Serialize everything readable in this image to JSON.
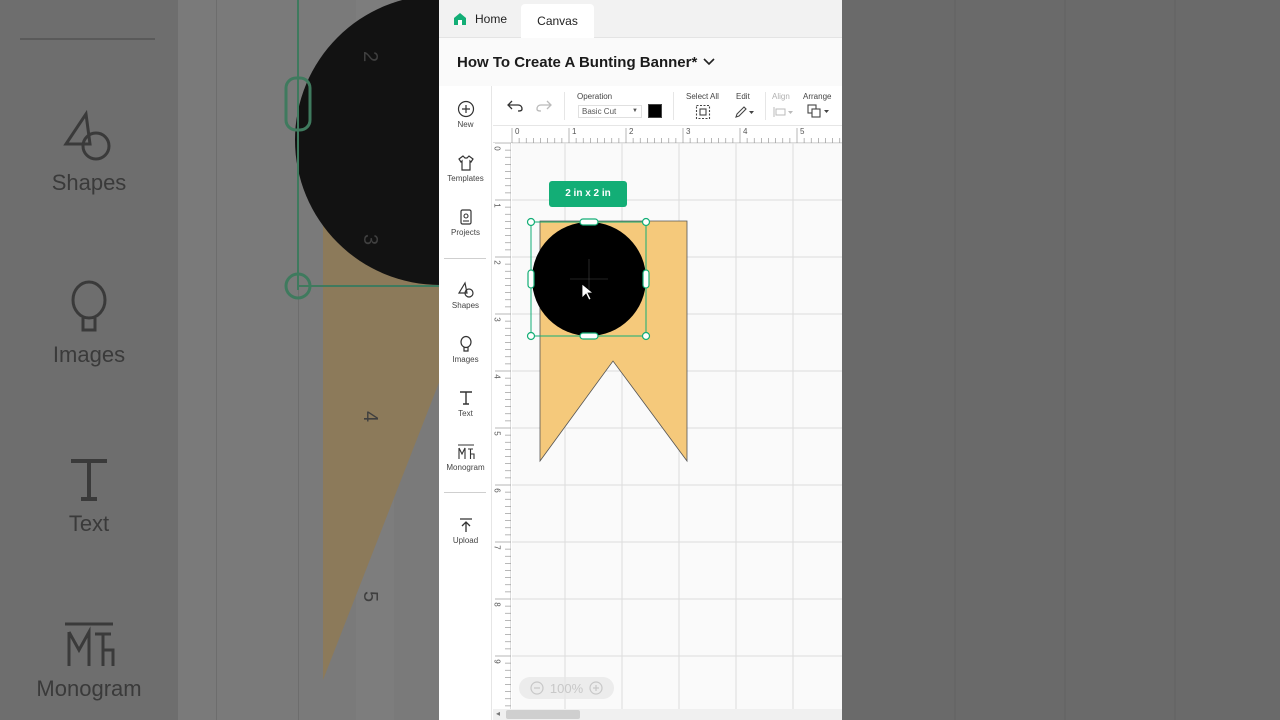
{
  "background": {
    "sidebar_items": [
      "Shapes",
      "Images",
      "Text",
      "Monogram"
    ],
    "ruler_numbers": [
      "2",
      "3",
      "4",
      "5"
    ]
  },
  "tabs": {
    "home": "Home",
    "canvas": "Canvas"
  },
  "project": {
    "title": "How To Create A Bunting Banner*"
  },
  "sidebar": {
    "items": [
      {
        "label": "New",
        "icon": "plus-circle-icon"
      },
      {
        "label": "Templates",
        "icon": "shirt-icon"
      },
      {
        "label": "Projects",
        "icon": "projects-icon"
      },
      {
        "label": "Shapes",
        "icon": "shapes-icon"
      },
      {
        "label": "Images",
        "icon": "lightbulb-icon"
      },
      {
        "label": "Text",
        "icon": "text-t-icon"
      },
      {
        "label": "Monogram",
        "icon": "monogram-icon"
      },
      {
        "label": "Upload",
        "icon": "upload-icon"
      }
    ]
  },
  "toolbar": {
    "operation_label": "Operation",
    "operation_value": "Basic Cut",
    "select_all_label": "Select All",
    "edit_label": "Edit",
    "align_label": "Align",
    "arrange_label": "Arrange",
    "swatch_color": "#000000"
  },
  "rulers": {
    "top": [
      "0",
      "1",
      "2",
      "3",
      "4",
      "5"
    ],
    "left": [
      "0",
      "1",
      "2",
      "3",
      "4",
      "5",
      "6",
      "7",
      "8",
      "9"
    ]
  },
  "selection": {
    "size_label": "2 in x 2 in"
  },
  "zoom": {
    "level": "100%"
  },
  "colors": {
    "accent": "#13ae76",
    "banner_fill": "#f5c97b",
    "circle_fill": "#000000"
  }
}
